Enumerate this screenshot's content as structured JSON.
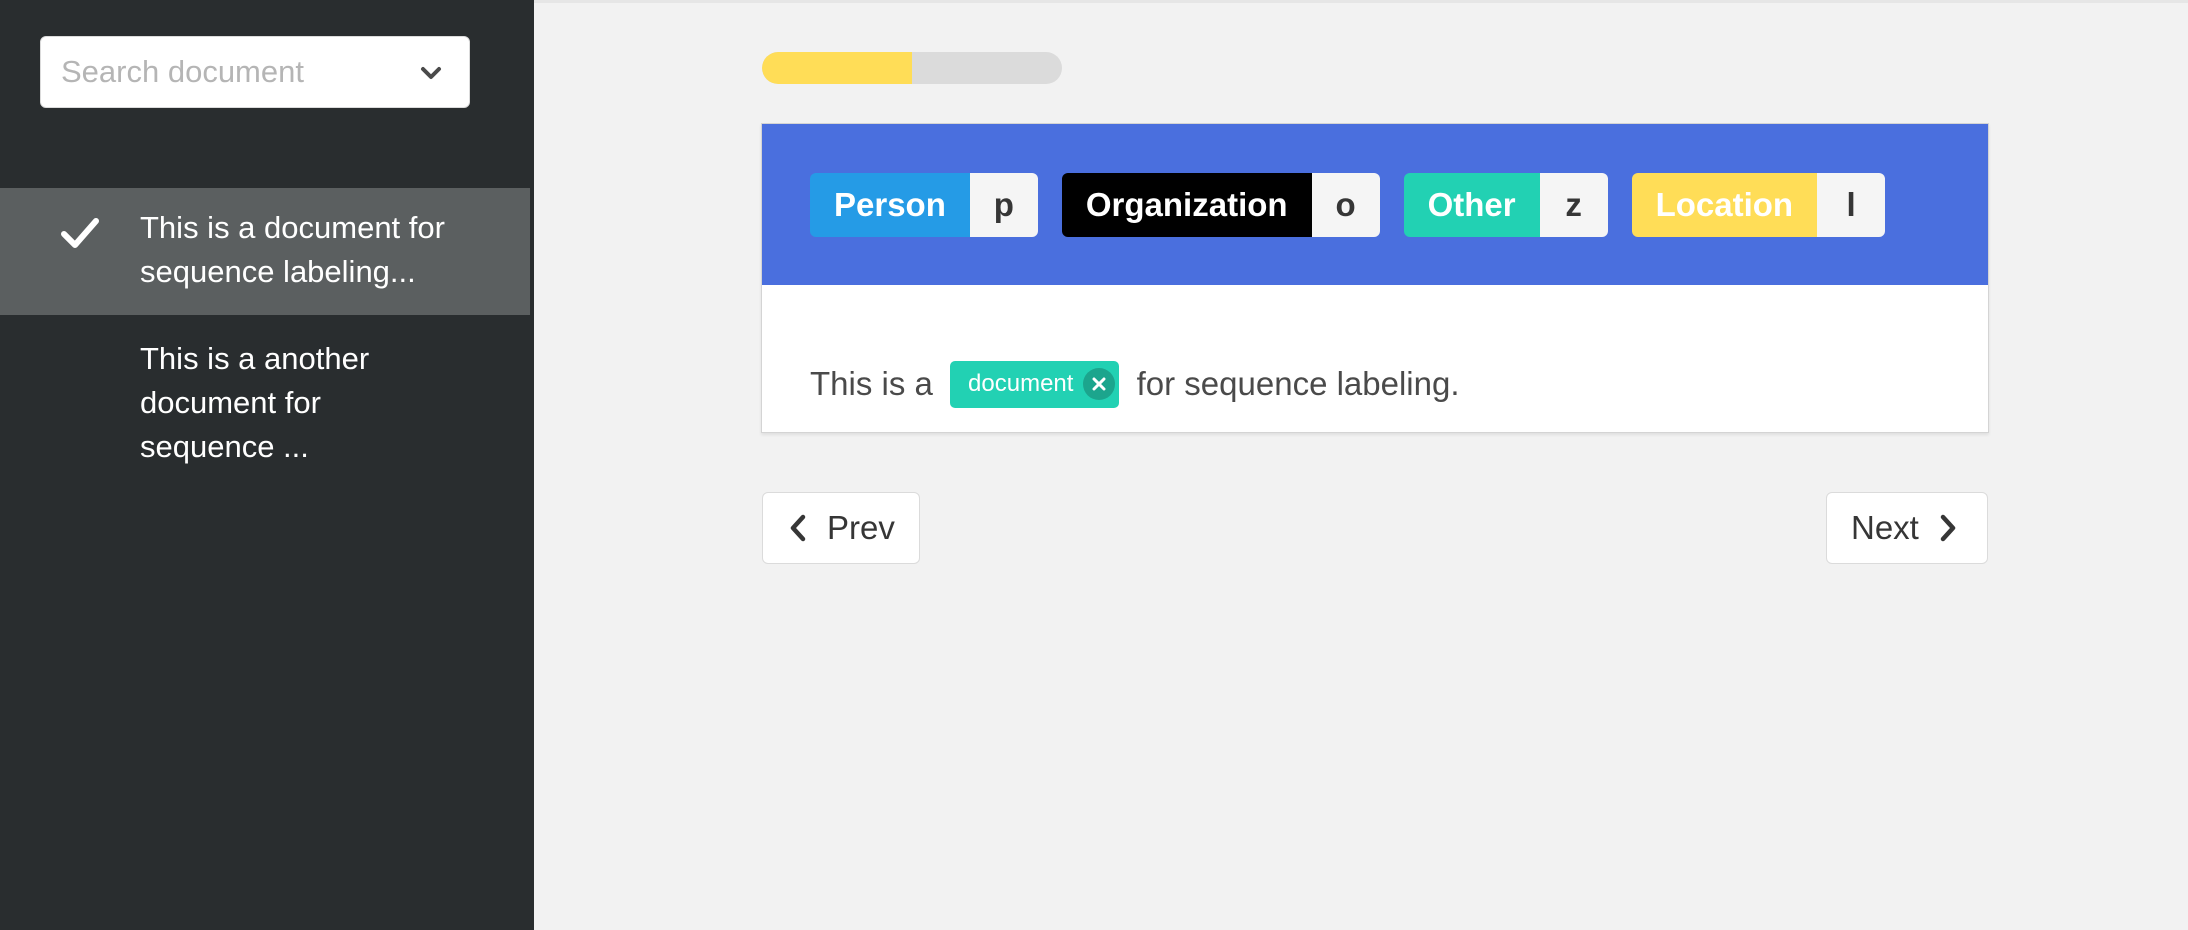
{
  "sidebar": {
    "search": {
      "placeholder": "Search document",
      "value": ""
    },
    "documents": [
      {
        "line1": "This is a document for",
        "line2": "sequence labeling...",
        "line3": "",
        "active": true
      },
      {
        "line1": "This is a another",
        "line2": "document for",
        "line3": "sequence ...",
        "active": false
      }
    ]
  },
  "progress": {
    "value": 0.5,
    "color": "#ffdd57"
  },
  "labels": [
    {
      "name": "Person",
      "key": "p",
      "color": "#259be6"
    },
    {
      "name": "Organization",
      "key": "o",
      "color": "#000000"
    },
    {
      "name": "Other",
      "key": "z",
      "color": "#22d1b3"
    },
    {
      "name": "Location",
      "key": "l",
      "color": "#ffdd57"
    }
  ],
  "annotation": {
    "text_before": "This is a ",
    "entity": {
      "text": "document",
      "label": "Other",
      "color": "#22d1b3"
    },
    "text_after": " for sequence labeling."
  },
  "navigation": {
    "prev_label": "Prev",
    "next_label": "Next"
  },
  "colors": {
    "header": "#4a6fde",
    "sidebar": "#292d2f",
    "active_item": "#5b5f60"
  }
}
